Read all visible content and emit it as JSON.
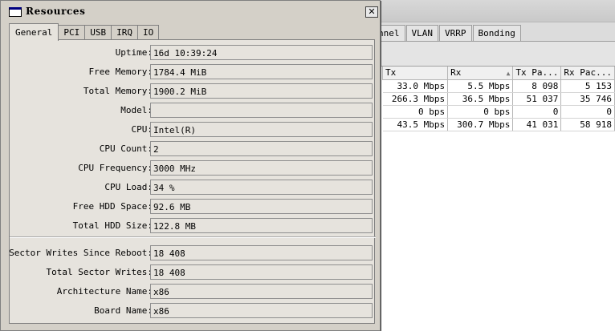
{
  "dialog": {
    "title": "Resources",
    "close_glyph": "✕",
    "tabs": [
      {
        "label": "General"
      },
      {
        "label": "PCI"
      },
      {
        "label": "USB"
      },
      {
        "label": "IRQ"
      },
      {
        "label": "IO"
      }
    ],
    "fields": [
      {
        "label": "Uptime:",
        "value": "16d 10:39:24"
      },
      {
        "label": "Free Memory:",
        "value": "1784.4 MiB"
      },
      {
        "label": "Total Memory:",
        "value": "1900.2 MiB"
      },
      {
        "label": "Model:",
        "value": ""
      },
      {
        "label": "CPU:",
        "value": "Intel(R)"
      },
      {
        "label": "CPU Count:",
        "value": "2"
      },
      {
        "label": "CPU Frequency:",
        "value": "3000 MHz"
      },
      {
        "label": "CPU Load:",
        "value": "34 %"
      },
      {
        "label": "Free HDD Space:",
        "value": "92.6 MB"
      },
      {
        "label": "Total HDD Size:",
        "value": "122.8 MB"
      },
      {
        "label": "Sector Writes Since Reboot:",
        "value": "18 408"
      },
      {
        "label": "Total Sector Writes:",
        "value": "18 408"
      },
      {
        "label": "Architecture Name:",
        "value": "x86"
      },
      {
        "label": "Board Name:",
        "value": "x86"
      }
    ]
  },
  "background": {
    "tabs": [
      "nnel",
      "VLAN",
      "VRRP",
      "Bonding"
    ],
    "table": {
      "columns": [
        "Tx",
        "Rx",
        "Tx Pa...",
        "Rx Pac..."
      ],
      "rows": [
        [
          "33.0 Mbps",
          "5.5 Mbps",
          "8 098",
          "5 153"
        ],
        [
          "266.3 Mbps",
          "36.5 Mbps",
          "51 037",
          "35 746"
        ],
        [
          "0 bps",
          "0 bps",
          "0",
          "0"
        ],
        [
          "43.5 Mbps",
          "300.7 Mbps",
          "41 031",
          "58 918"
        ]
      ]
    }
  }
}
